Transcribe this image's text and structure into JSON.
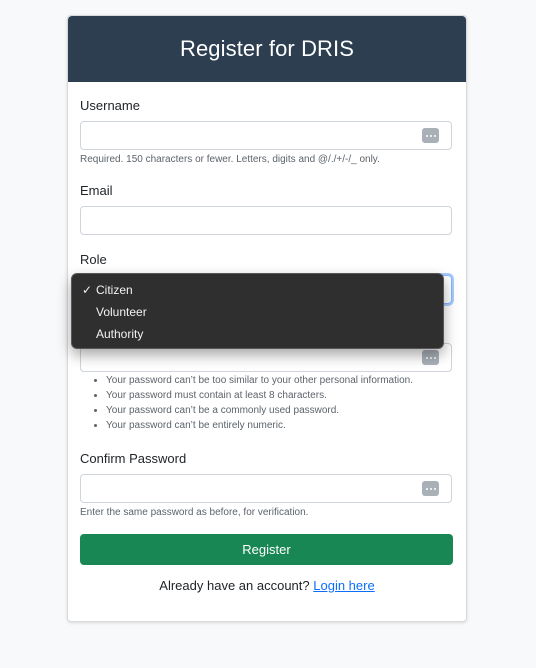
{
  "header": {
    "title": "Register for DRIS"
  },
  "form": {
    "username_label": "Username",
    "username_help": "Required. 150 characters or fewer. Letters, digits and @/./+/-/_ only.",
    "email_label": "Email",
    "role_label": "Role",
    "password_rules": [
      "Your password can’t be too similar to your other personal information.",
      "Your password must contain at least 8 characters.",
      "Your password can’t be a commonly used password.",
      "Your password can’t be entirely numeric."
    ],
    "confirm_label": "Confirm Password",
    "confirm_help": "Enter the same password as before, for verification.",
    "submit_label": "Register"
  },
  "role_dropdown": {
    "options": [
      "Citizen",
      "Volunteer",
      "Authority"
    ],
    "selected": "Citizen",
    "check_glyph": "✓"
  },
  "footer": {
    "prompt": "Already have an account?",
    "link_label": "Login here"
  },
  "colors": {
    "header_bg": "#2c3e50",
    "button_bg": "#198754",
    "link": "#0d6efd",
    "dropdown_bg": "#2f2f2f"
  },
  "icons": {
    "password_manager": "password-dots-icon",
    "check": "checkmark-icon"
  }
}
